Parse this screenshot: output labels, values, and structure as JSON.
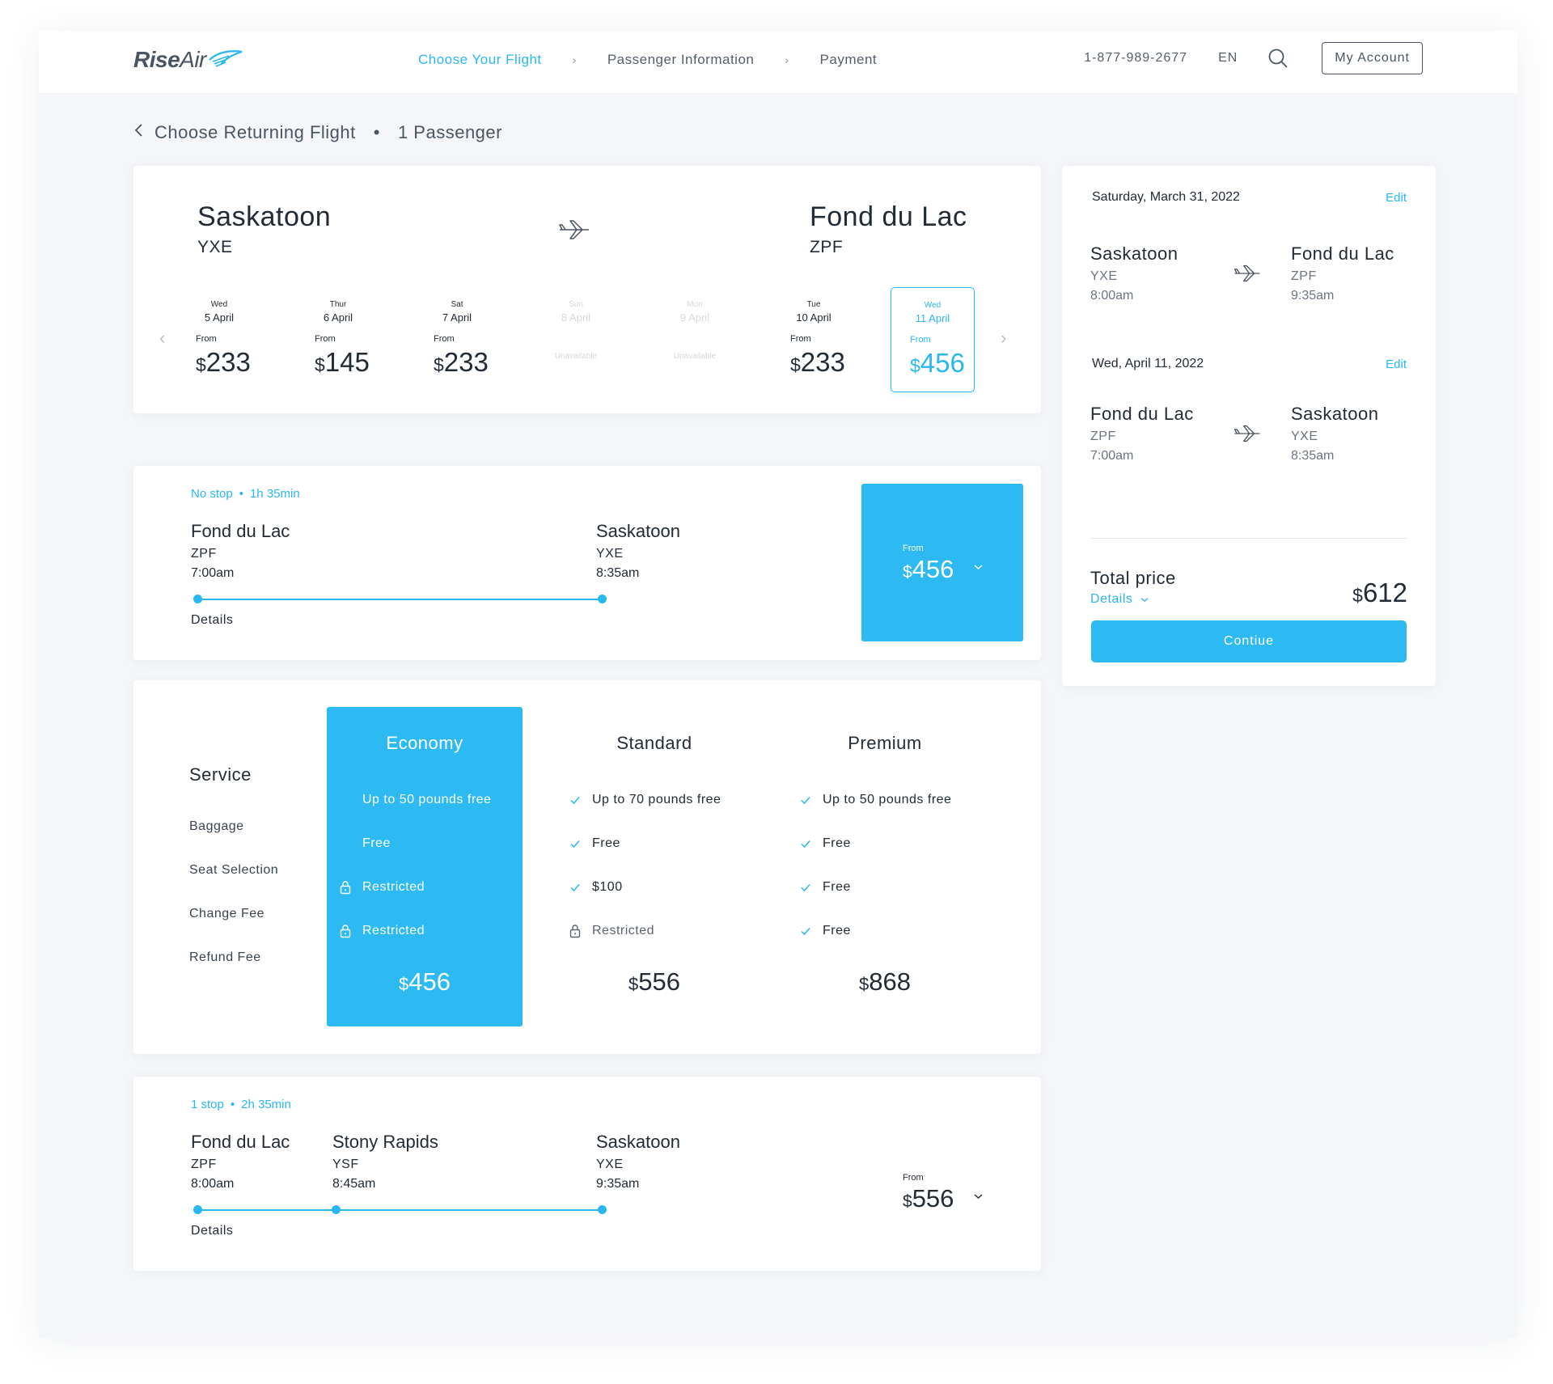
{
  "brand": {
    "name_a": "Rise",
    "name_b": "Air"
  },
  "nav": {
    "steps": [
      "Choose Your Flight",
      "Passenger Information",
      "Payment"
    ],
    "phone": "1-877-989-2677",
    "lang": "EN",
    "account": "My Account"
  },
  "crumb": {
    "title": "Choose Returning Flight",
    "passengers": "1 Passenger"
  },
  "route": {
    "from": {
      "city": "Saskatoon",
      "code": "YXE"
    },
    "to": {
      "city": "Fond du Lac",
      "code": "ZPF"
    }
  },
  "dates": [
    {
      "dow": "Wed",
      "dm": "5 April",
      "from": "From",
      "currency": "$",
      "price": "233"
    },
    {
      "dow": "Thur",
      "dm": "6 April",
      "from": "From",
      "currency": "$",
      "price": "145"
    },
    {
      "dow": "Sat",
      "dm": "7 April",
      "from": "From",
      "currency": "$",
      "price": "233"
    },
    {
      "dow": "Sun",
      "dm": "8 April",
      "unavailable": "Unavailable"
    },
    {
      "dow": "Mon",
      "dm": "9 April",
      "unavailable": "Unavailable"
    },
    {
      "dow": "Tue",
      "dm": "10 April",
      "from": "From",
      "currency": "$",
      "price": "233"
    },
    {
      "dow": "Wed",
      "dm": "11 April",
      "from": "From",
      "currency": "$",
      "price": "456"
    }
  ],
  "flight1": {
    "stops": "No stop",
    "duration": "1h 35min",
    "origin": {
      "city": "Fond du Lac",
      "code": "ZPF",
      "time": "7:00am"
    },
    "dest": {
      "city": "Saskatoon",
      "code": "YXE",
      "time": "8:35am"
    },
    "details": "Details",
    "from": "From",
    "currency": "$",
    "price": "456"
  },
  "fares": {
    "service_title": "Service",
    "rows": [
      "Baggage",
      "Seat Selection",
      "Change Fee",
      "Refund Fee"
    ],
    "columns": [
      {
        "name": "Economy",
        "features": [
          "Up to 50 pounds free",
          "Free",
          "Restricted",
          "Restricted"
        ],
        "currency": "$",
        "price": "456"
      },
      {
        "name": "Standard",
        "features": [
          "Up to 70 pounds free",
          "Free",
          "$100",
          "Restricted"
        ],
        "currency": "$",
        "price": "556"
      },
      {
        "name": "Premium",
        "features": [
          "Up to 50 pounds free",
          "Free",
          "Free",
          "Free"
        ],
        "currency": "$",
        "price": "868"
      }
    ]
  },
  "flight2": {
    "stops": "1 stop",
    "duration": "2h 35min",
    "origin": {
      "city": "Fond du Lac",
      "code": "ZPF",
      "time": "8:00am"
    },
    "via": {
      "city": "Stony Rapids",
      "code": "YSF",
      "time": "8:45am"
    },
    "dest": {
      "city": "Saskatoon",
      "code": "YXE",
      "time": "9:35am"
    },
    "details": "Details",
    "from": "From",
    "currency": "$",
    "price": "556"
  },
  "summary": {
    "outbound": {
      "date": "Saturday, March 31, 2022",
      "edit": "Edit",
      "from": {
        "city": "Saskatoon",
        "code": "YXE",
        "time": "8:00am"
      },
      "to": {
        "city": "Fond du Lac",
        "code": "ZPF",
        "time": "9:35am"
      }
    },
    "return": {
      "date": "Wed, April 11, 2022",
      "edit": "Edit",
      "from": {
        "city": "Fond du Lac",
        "code": "ZPF",
        "time": "7:00am"
      },
      "to": {
        "city": "Saskatoon",
        "code": "YXE",
        "time": "8:35am"
      }
    },
    "total_label": "Total price",
    "details": "Details",
    "currency": "$",
    "total": "612",
    "continue": "Contiue"
  },
  "colors": {
    "accent": "#2ab7f0",
    "text": "#222b36",
    "bg": "#f4f6f9"
  }
}
